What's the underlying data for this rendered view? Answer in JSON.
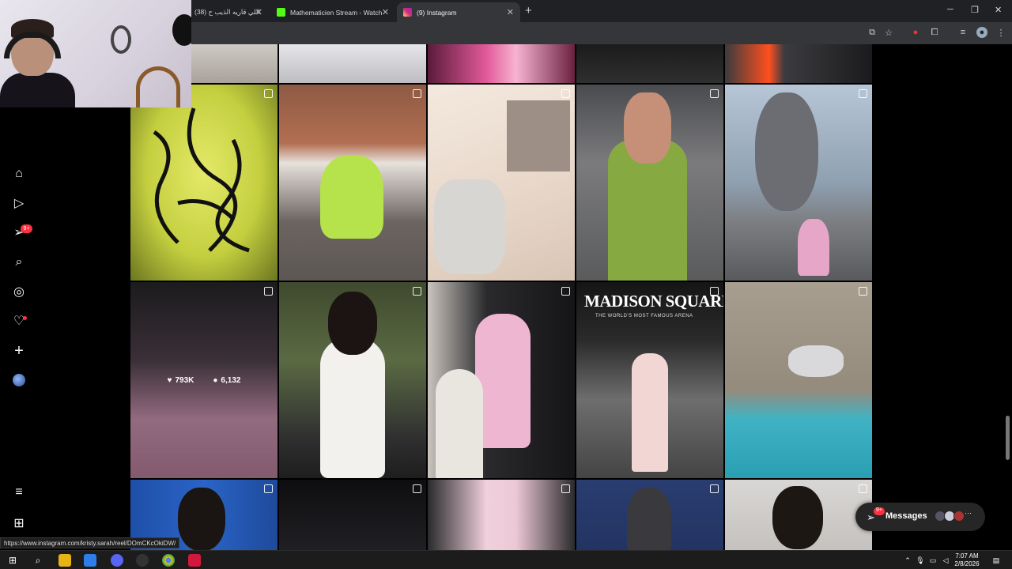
{
  "browser": {
    "tabs": [
      {
        "title": "(38) اللي قاريه الذيب ح",
        "icon_color": "#ff0000"
      },
      {
        "title": "Mathematicien Stream - Watch",
        "icon_color": "#53fc18"
      },
      {
        "title": "(9) Instagram",
        "icon_color": "#e1306c"
      }
    ],
    "new_tab_symbol": "+",
    "close_symbol": "✕"
  },
  "nav": {
    "notification_badge": "9+",
    "icons": [
      "home-icon",
      "reels-icon",
      "messages-icon",
      "search-icon",
      "explore-icon",
      "notifications-icon",
      "create-icon",
      "profile-avatar",
      "menu-icon",
      "meta-apps-icon"
    ]
  },
  "grid": {
    "hovered_post": {
      "likes": "793K",
      "comments": "6,132"
    },
    "venue_sign": {
      "title": "MADISON SQUARE GARDEN",
      "subtitle": "THE WORLD'S MOST FAMOUS ARENA"
    }
  },
  "messages": {
    "label": "Messages",
    "badge": "9+"
  },
  "status_url": "https://www.instagram.com/kristy.sarah/reel/DOmCKcOkiDW/",
  "clock": {
    "time": "7:07 AM",
    "date": "2/8/2026"
  },
  "colors": {
    "accent_red": "#ff3040",
    "page_bg": "#000000",
    "chrome_bg": "#202124"
  }
}
